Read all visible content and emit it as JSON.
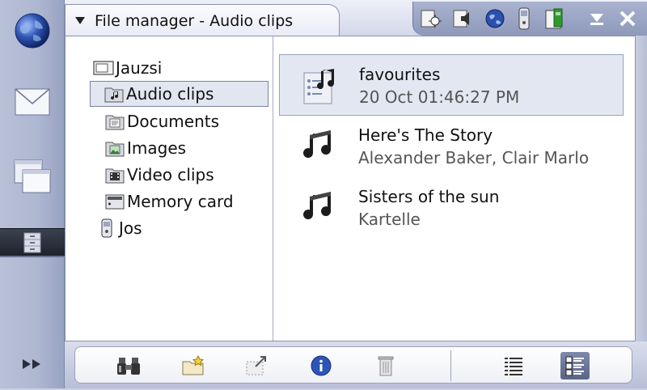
{
  "window": {
    "title": "File manager - Audio clips"
  },
  "tasknav": {
    "items": [
      {
        "name": "web"
      },
      {
        "name": "messaging"
      },
      {
        "name": "applications"
      },
      {
        "name": "file-manager",
        "selected": true
      },
      {
        "name": "more"
      }
    ]
  },
  "status_icons": [
    "brightness",
    "volume",
    "internet",
    "phone",
    "battery"
  ],
  "tree": {
    "items": [
      {
        "label": "Jauzsi",
        "icon": "device-icon",
        "level": 0
      },
      {
        "label": "Audio clips",
        "icon": "audio-folder-icon",
        "level": 1,
        "selected": true
      },
      {
        "label": "Documents",
        "icon": "documents-folder-icon",
        "level": 1
      },
      {
        "label": "Images",
        "icon": "images-folder-icon",
        "level": 1
      },
      {
        "label": "Video clips",
        "icon": "video-folder-icon",
        "level": 1
      },
      {
        "label": "Memory card",
        "icon": "memory-card-icon",
        "level": 1
      },
      {
        "label": "Jos",
        "icon": "phone-icon",
        "level": 0
      }
    ]
  },
  "files": [
    {
      "name": "favourites",
      "sub": "20 Oct 01:46:27 PM",
      "icon": "playlist-icon",
      "selected": true
    },
    {
      "name": "Here's The Story",
      "sub": "Alexander Baker, Clair Marlo",
      "icon": "music-note-icon"
    },
    {
      "name": "Sisters of the sun",
      "sub": "Kartelle",
      "icon": "music-note-icon"
    }
  ],
  "toolbar": [
    "search",
    "new-folder",
    "move",
    "details",
    "delete",
    "list-view",
    "detail-view"
  ],
  "colors": {
    "selection": "#e2e6f0",
    "accent": "#59648a",
    "panel": "#b9c1d8"
  }
}
